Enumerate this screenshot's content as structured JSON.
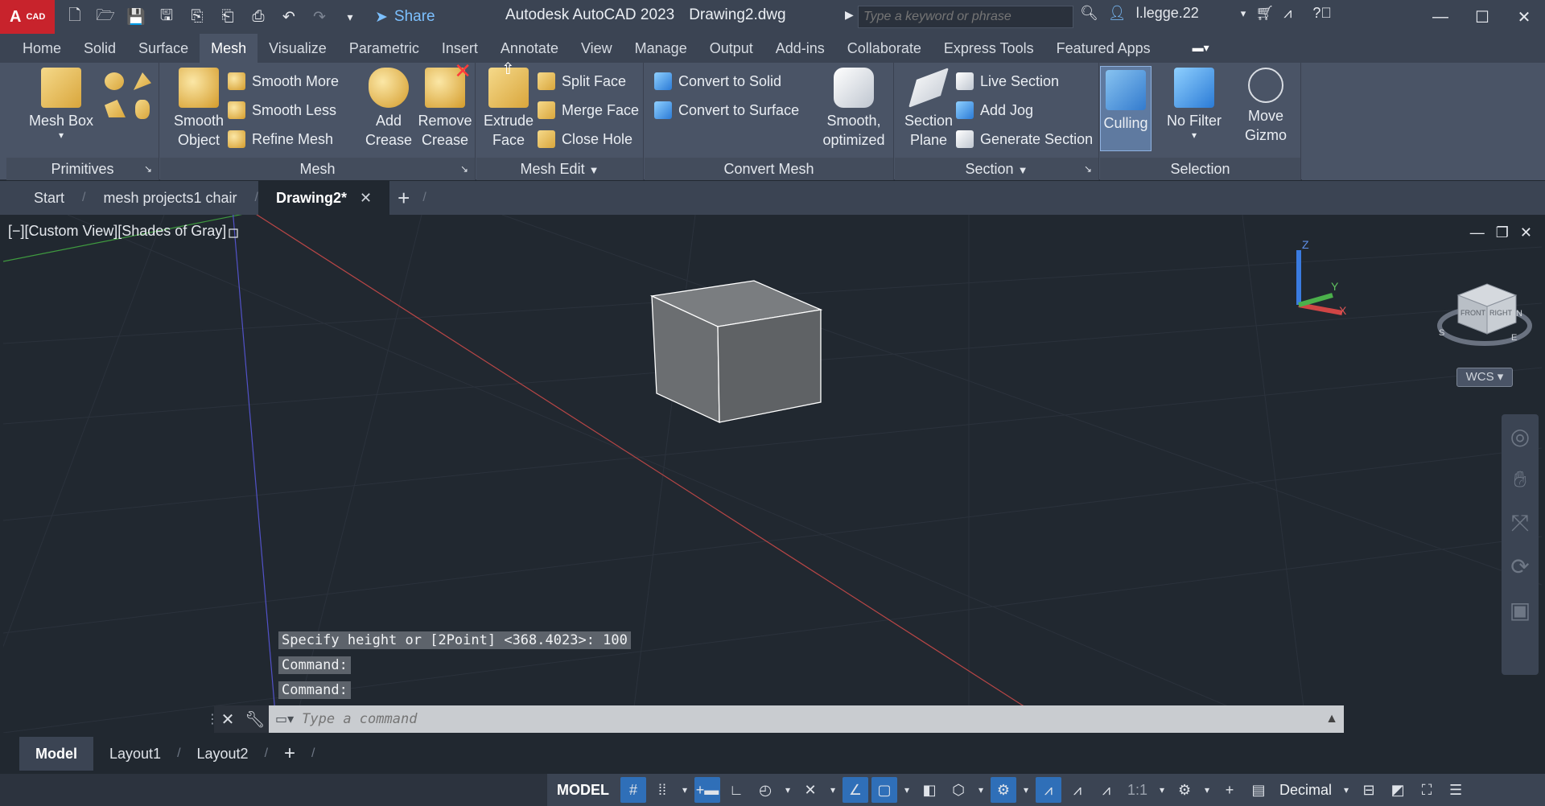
{
  "app": {
    "logo_letter": "A",
    "logo_sub": "CAD",
    "title": "Autodesk AutoCAD 2023",
    "document": "Drawing2.dwg",
    "share_label": "Share",
    "search_placeholder": "Type a keyword or phrase",
    "user": "l.legge.22"
  },
  "ribbon_tabs": [
    "Home",
    "Solid",
    "Surface",
    "Mesh",
    "Visualize",
    "Parametric",
    "Insert",
    "Annotate",
    "View",
    "Manage",
    "Output",
    "Add-ins",
    "Collaborate",
    "Express Tools",
    "Featured Apps"
  ],
  "active_tab": "Mesh",
  "ribbon": {
    "primitives": {
      "title": "Primitives",
      "mesh_box": "Mesh Box"
    },
    "mesh": {
      "title": "Mesh",
      "smooth_object_1": "Smooth",
      "smooth_object_2": "Object",
      "smooth_more": "Smooth More",
      "smooth_less": "Smooth Less",
      "refine_mesh": "Refine Mesh",
      "add_crease_1": "Add",
      "add_crease_2": "Crease",
      "remove_crease_1": "Remove",
      "remove_crease_2": "Crease"
    },
    "mesh_edit": {
      "title": "Mesh Edit",
      "extrude_face_1": "Extrude",
      "extrude_face_2": "Face",
      "split_face": "Split Face",
      "merge_face": "Merge Face",
      "close_hole": "Close Hole"
    },
    "convert_mesh": {
      "title": "Convert Mesh",
      "convert_to_solid": "Convert to Solid",
      "convert_to_surface": "Convert to Surface",
      "smooth_optimized_1": "Smooth,",
      "smooth_optimized_2": "optimized"
    },
    "section": {
      "title": "Section",
      "section_plane_1": "Section",
      "section_plane_2": "Plane",
      "live_section": "Live Section",
      "add_jog": "Add Jog",
      "generate_section": "Generate Section"
    },
    "selection": {
      "title": "Selection",
      "culling": "Culling",
      "no_filter": "No Filter",
      "move_gizmo_1": "Move",
      "move_gizmo_2": "Gizmo"
    }
  },
  "file_tabs": {
    "start": "Start",
    "file1": "mesh projects1 chair",
    "file2": "Drawing2*"
  },
  "viewport": {
    "label": "[−][Custom View][Shades of Gray]",
    "wcs": "WCS",
    "viewcube_top": "FRONT",
    "viewcube_right": "RIGHT",
    "axis_z": "Z",
    "axis_y": "Y",
    "axis_x": "X",
    "compass_s": "S",
    "compass_e": "E",
    "compass_n": "N"
  },
  "command": {
    "history": [
      "Specify height or [2Point] <368.4023>: 100",
      "Command:",
      "Command:"
    ],
    "placeholder": "Type a command"
  },
  "layout_tabs": [
    "Model",
    "Layout1",
    "Layout2"
  ],
  "status": {
    "model": "MODEL",
    "scale": "1:1",
    "units": "Decimal"
  },
  "colors": {
    "accent": "#2f6fb8",
    "viewport_bg": "#212830",
    "ribbon_bg": "#4a5466"
  }
}
